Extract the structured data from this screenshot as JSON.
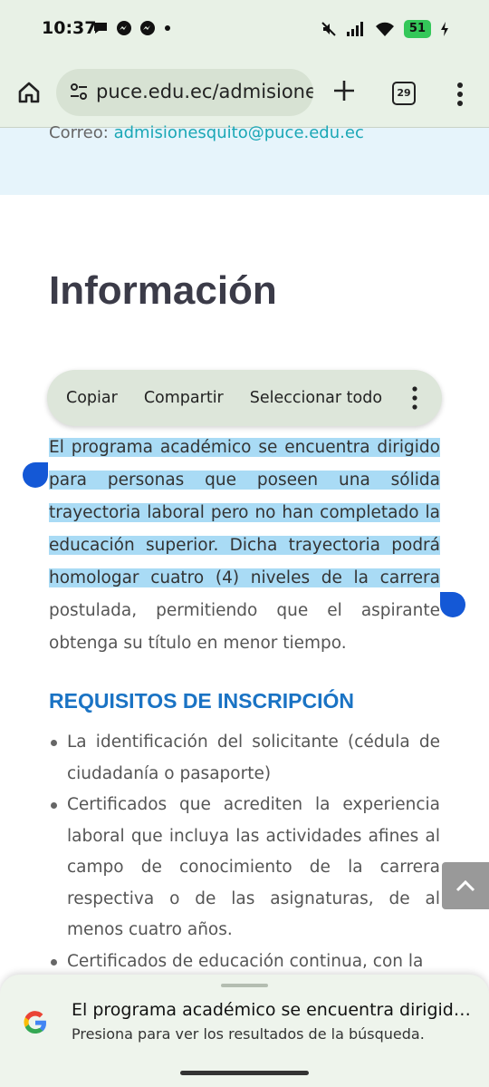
{
  "status": {
    "time": "10:37",
    "battery": "51",
    "left_icons": [
      "chat-bubble-icon",
      "messenger-icon",
      "messenger-icon",
      "dot-icon"
    ],
    "right_icons": [
      "mute-icon",
      "signal-icon",
      "wifi-icon",
      "battery-icon",
      "charging-icon"
    ]
  },
  "browser": {
    "url": "puce.edu.ec/admisiones",
    "tab_count": "29"
  },
  "page": {
    "contact_label": "Correo:",
    "contact_email": "admisionesquito@puce.edu.ec",
    "heading": "Información",
    "paragraph_selected": "El programa académico se encuentra dirigido para personas que poseen una sólida trayectoria laboral pero no han completado la educación superior. Dicha trayectoria podrá homologar cuatro (4) niveles de la carrera",
    "paragraph_rest": " postulada, permitiendo que el aspirante obtenga su título en menor tiempo.",
    "requirements_title": "REQUISITOS DE INSCRIPCIÓN",
    "requirements": [
      "La identificación del solicitante (cédula de ciudadanía o pasaporte)",
      "Certificados que acrediten la experiencia laboral que incluya las actividades afines al campo de conocimiento de la carrera respectiva o de las asignaturas, de al menos cuatro años.",
      "Certificados de educación continua, con la"
    ]
  },
  "context_menu": {
    "copy": "Copiar",
    "share": "Compartir",
    "select_all": "Seleccionar todo"
  },
  "search_sheet": {
    "title": "El programa académico se encuentra dirigid…",
    "subtitle": "Presiona para ver los resultados de la búsqueda."
  },
  "colors": {
    "selection": "#a9dbf5",
    "handle": "#1458d6",
    "link": "#1aa7b5",
    "section_title": "#1a73c4"
  }
}
